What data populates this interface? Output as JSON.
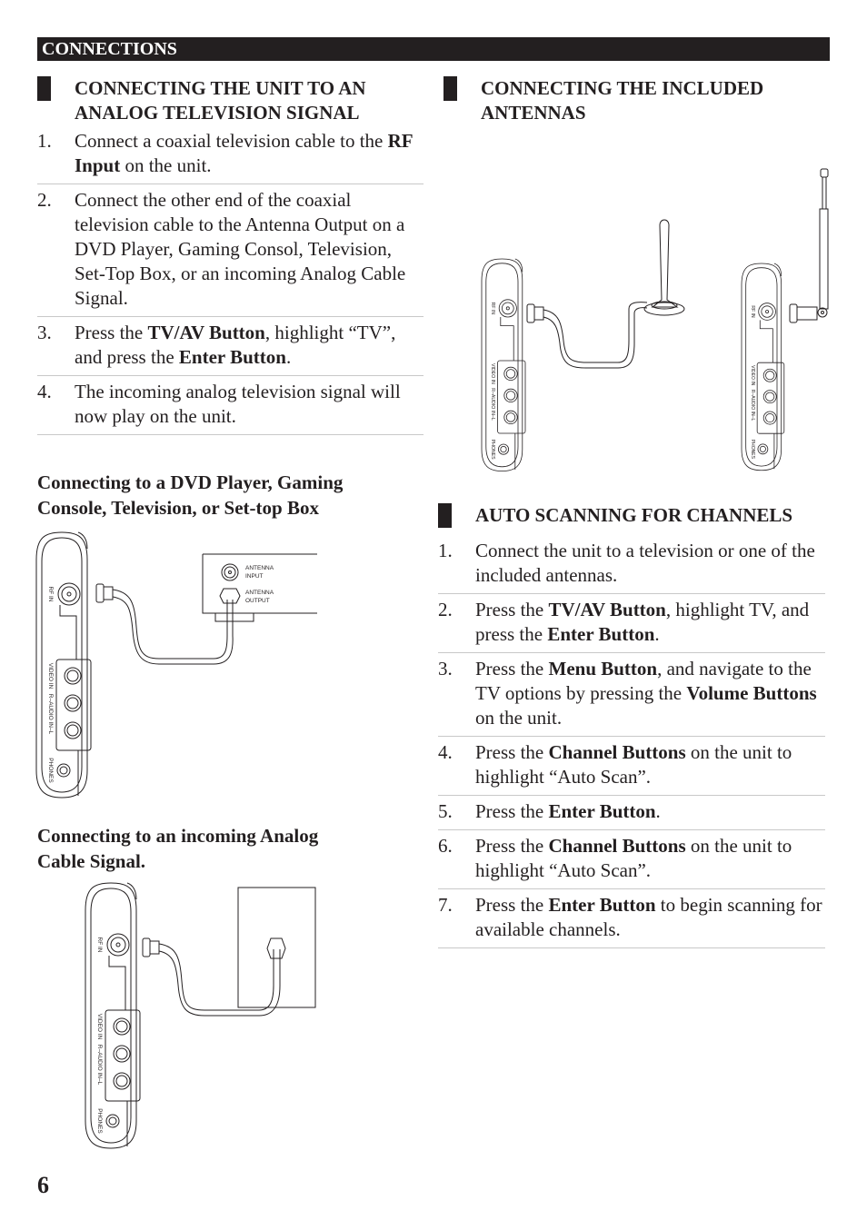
{
  "header": {
    "title": "CONNECTIONS"
  },
  "page_number": "6",
  "left": {
    "section_title_line1": "CONNECTING THE UNIT TO AN",
    "section_title_line2": "ANALOG TELEVISION SIGNAL",
    "steps": [
      {
        "num": "1.",
        "parts": [
          {
            "t": "Connect a coaxial television cable to the "
          },
          {
            "t": "RF Input",
            "b": true
          },
          {
            "t": " on the unit."
          }
        ]
      },
      {
        "num": "2.",
        "parts": [
          {
            "t": "Connect the other end of the coaxial television cable to the Antenna Output on a DVD Player, Gaming Consol, Television, Set-Top Box, or an incoming Analog Cable Signal."
          }
        ]
      },
      {
        "num": "3.",
        "parts": [
          {
            "t": "Press the "
          },
          {
            "t": "TV/AV Button",
            "b": true
          },
          {
            "t": ", highlight “TV”, and press the "
          },
          {
            "t": "Enter Button",
            "b": true
          },
          {
            "t": "."
          }
        ]
      },
      {
        "num": "4.",
        "parts": [
          {
            "t": "The incoming analog television signal will now play on the unit."
          }
        ]
      }
    ],
    "subhead_dvd_line1": "Connecting to a DVD Player, Gaming",
    "subhead_dvd_line2": "Console, Television, or Set-top Box",
    "subhead_cable_line1": "Connecting to an incoming Analog",
    "subhead_cable_line2": "Cable Signal.",
    "diagram_dvd": {
      "antenna_input_label_1": "ANTENNA",
      "antenna_input_label_2": "INPUT",
      "antenna_output_label_1": "ANTENNA",
      "antenna_output_label_2": "OUTPUT"
    },
    "unit_labels": {
      "rf_in": "RF IN",
      "video_in": "VIDEO IN",
      "audio_in": "R–AUDIO IN–L",
      "phones": "PHONES"
    }
  },
  "right": {
    "section_title_line1": "CONNECTING THE INCLUDED",
    "section_title_line2": "ANTENNAS",
    "scan_title": "AUTO SCANNING FOR CHANNELS",
    "steps": [
      {
        "num": "1.",
        "parts": [
          {
            "t": "Connect the unit to a television or one of the included antennas."
          }
        ]
      },
      {
        "num": "2.",
        "parts": [
          {
            "t": "Press the "
          },
          {
            "t": "TV/AV Button",
            "b": true
          },
          {
            "t": ", highlight TV, and press the "
          },
          {
            "t": "Enter Button",
            "b": true
          },
          {
            "t": "."
          }
        ]
      },
      {
        "num": "3.",
        "parts": [
          {
            "t": "Press the "
          },
          {
            "t": "Menu Button",
            "b": true
          },
          {
            "t": ", and navigate to the TV options by pressing the "
          },
          {
            "t": "Volume Buttons",
            "b": true
          },
          {
            "t": " on the unit."
          }
        ]
      },
      {
        "num": "4.",
        "parts": [
          {
            "t": "Press the "
          },
          {
            "t": "Channel Buttons",
            "b": true
          },
          {
            "t": " on the unit to highlight “Auto Scan”."
          }
        ]
      },
      {
        "num": "5.",
        "parts": [
          {
            "t": "Press the "
          },
          {
            "t": "Enter Button",
            "b": true
          },
          {
            "t": "."
          }
        ]
      },
      {
        "num": "6.",
        "parts": [
          {
            "t": "Press the "
          },
          {
            "t": "Channel Buttons",
            "b": true
          },
          {
            "t": " on the unit to highlight “Auto Scan”."
          }
        ]
      },
      {
        "num": "7.",
        "parts": [
          {
            "t": "Press the "
          },
          {
            "t": "Enter Button",
            "b": true
          },
          {
            "t": " to begin scanning for available channels."
          }
        ]
      }
    ]
  }
}
